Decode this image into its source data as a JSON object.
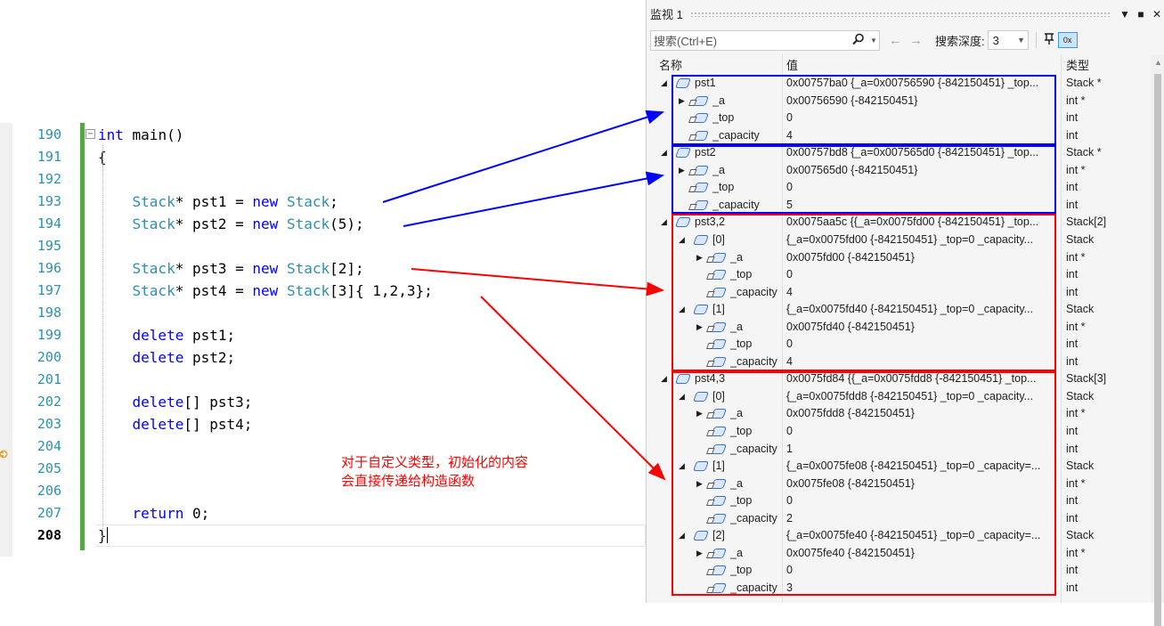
{
  "editor": {
    "lines": [
      {
        "num": "190",
        "code": [
          {
            "t": "int",
            "c": "kw"
          },
          {
            "t": " main()"
          }
        ]
      },
      {
        "num": "191",
        "code": [
          {
            "t": "{"
          }
        ]
      },
      {
        "num": "192",
        "code": []
      },
      {
        "num": "193",
        "code": [
          {
            "t": "    "
          },
          {
            "t": "Stack",
            "c": "ty"
          },
          {
            "t": "* pst1 = "
          },
          {
            "t": "new",
            "c": "kw"
          },
          {
            "t": " "
          },
          {
            "t": "Stack",
            "c": "ty"
          },
          {
            "t": ";"
          }
        ]
      },
      {
        "num": "194",
        "code": [
          {
            "t": "    "
          },
          {
            "t": "Stack",
            "c": "ty"
          },
          {
            "t": "* pst2 = "
          },
          {
            "t": "new",
            "c": "kw"
          },
          {
            "t": " "
          },
          {
            "t": "Stack",
            "c": "ty"
          },
          {
            "t": "(5);"
          }
        ]
      },
      {
        "num": "195",
        "code": []
      },
      {
        "num": "196",
        "code": [
          {
            "t": "    "
          },
          {
            "t": "Stack",
            "c": "ty"
          },
          {
            "t": "* pst3 = "
          },
          {
            "t": "new",
            "c": "kw"
          },
          {
            "t": " "
          },
          {
            "t": "Stack",
            "c": "ty"
          },
          {
            "t": "[2];"
          }
        ]
      },
      {
        "num": "197",
        "code": [
          {
            "t": "    "
          },
          {
            "t": "Stack",
            "c": "ty"
          },
          {
            "t": "* pst4 = "
          },
          {
            "t": "new",
            "c": "kw"
          },
          {
            "t": " "
          },
          {
            "t": "Stack",
            "c": "ty"
          },
          {
            "t": "[3]{ 1,2,3};"
          }
        ]
      },
      {
        "num": "198",
        "code": []
      },
      {
        "num": "199",
        "code": [
          {
            "t": "    "
          },
          {
            "t": "delete",
            "c": "kw"
          },
          {
            "t": " pst1;"
          }
        ]
      },
      {
        "num": "200",
        "code": [
          {
            "t": "    "
          },
          {
            "t": "delete",
            "c": "kw"
          },
          {
            "t": " pst2;"
          }
        ]
      },
      {
        "num": "201",
        "code": []
      },
      {
        "num": "202",
        "code": [
          {
            "t": "    "
          },
          {
            "t": "delete",
            "c": "kw"
          },
          {
            "t": "[] pst3;"
          }
        ]
      },
      {
        "num": "203",
        "code": [
          {
            "t": "    "
          },
          {
            "t": "delete",
            "c": "kw"
          },
          {
            "t": "[] pst4;"
          }
        ]
      },
      {
        "num": "204",
        "code": []
      },
      {
        "num": "205",
        "code": []
      },
      {
        "num": "206",
        "code": []
      },
      {
        "num": "207",
        "code": [
          {
            "t": "    "
          },
          {
            "t": "return",
            "c": "kw"
          },
          {
            "t": " 0;"
          }
        ]
      },
      {
        "num": "208",
        "code": [
          {
            "t": "}"
          }
        ]
      }
    ],
    "current_line": "208"
  },
  "annotation": {
    "line1": "对于自定义类型，初始化的内容",
    "line2": "会直接传递给构造函数"
  },
  "watch": {
    "title": "监视 1",
    "buttons": {
      "dropdown": "▼",
      "maximize": "■",
      "close": "✕"
    },
    "search_placeholder": "搜索(Ctrl+E)",
    "search_icon": "search-icon",
    "depth_label": "搜索深度:",
    "depth_value": "3",
    "columns": {
      "name": "名称",
      "value": "值",
      "type": "类型"
    },
    "rows": [
      {
        "level": 0,
        "exp": "open",
        "icon": "obj",
        "name": "pst1",
        "value": "0x00757ba0 {_a=0x00756590 {-842150451} _top...",
        "type": "Stack *"
      },
      {
        "level": 1,
        "exp": "closed",
        "icon": "lock",
        "name": "_a",
        "value": "0x00756590 {-842150451}",
        "type": "int *"
      },
      {
        "level": 1,
        "exp": "",
        "icon": "lock",
        "name": "_top",
        "value": "0",
        "type": "int"
      },
      {
        "level": 1,
        "exp": "",
        "icon": "lock",
        "name": "_capacity",
        "value": "4",
        "type": "int"
      },
      {
        "level": 0,
        "exp": "open",
        "icon": "obj",
        "name": "pst2",
        "value": "0x00757bd8 {_a=0x007565d0 {-842150451} _top...",
        "type": "Stack *"
      },
      {
        "level": 1,
        "exp": "closed",
        "icon": "lock",
        "name": "_a",
        "value": "0x007565d0 {-842150451}",
        "type": "int *"
      },
      {
        "level": 1,
        "exp": "",
        "icon": "lock",
        "name": "_top",
        "value": "0",
        "type": "int"
      },
      {
        "level": 1,
        "exp": "",
        "icon": "lock",
        "name": "_capacity",
        "value": "5",
        "type": "int"
      },
      {
        "level": 0,
        "exp": "open",
        "icon": "obj",
        "name": "pst3,2",
        "value": "0x0075aa5c {{_a=0x0075fd00 {-842150451} _top...",
        "type": "Stack[2]"
      },
      {
        "level": 1,
        "exp": "open",
        "icon": "obj",
        "name": "[0]",
        "value": "{_a=0x0075fd00 {-842150451} _top=0 _capacity...",
        "type": "Stack"
      },
      {
        "level": 2,
        "exp": "closed",
        "icon": "lock",
        "name": "_a",
        "value": "0x0075fd00 {-842150451}",
        "type": "int *"
      },
      {
        "level": 2,
        "exp": "",
        "icon": "lock",
        "name": "_top",
        "value": "0",
        "type": "int"
      },
      {
        "level": 2,
        "exp": "",
        "icon": "lock",
        "name": "_capacity",
        "value": "4",
        "type": "int"
      },
      {
        "level": 1,
        "exp": "open",
        "icon": "obj",
        "name": "[1]",
        "value": "{_a=0x0075fd40 {-842150451} _top=0 _capacity...",
        "type": "Stack"
      },
      {
        "level": 2,
        "exp": "closed",
        "icon": "lock",
        "name": "_a",
        "value": "0x0075fd40 {-842150451}",
        "type": "int *"
      },
      {
        "level": 2,
        "exp": "",
        "icon": "lock",
        "name": "_top",
        "value": "0",
        "type": "int"
      },
      {
        "level": 2,
        "exp": "",
        "icon": "lock",
        "name": "_capacity",
        "value": "4",
        "type": "int"
      },
      {
        "level": 0,
        "exp": "open",
        "icon": "obj",
        "name": "pst4,3",
        "value": "0x0075fd84 {{_a=0x0075fdd8 {-842150451} _top...",
        "type": "Stack[3]"
      },
      {
        "level": 1,
        "exp": "open",
        "icon": "obj",
        "name": "[0]",
        "value": "{_a=0x0075fdd8 {-842150451} _top=0 _capacity...",
        "type": "Stack"
      },
      {
        "level": 2,
        "exp": "closed",
        "icon": "lock",
        "name": "_a",
        "value": "0x0075fdd8 {-842150451}",
        "type": "int *"
      },
      {
        "level": 2,
        "exp": "",
        "icon": "lock",
        "name": "_top",
        "value": "0",
        "type": "int"
      },
      {
        "level": 2,
        "exp": "",
        "icon": "lock",
        "name": "_capacity",
        "value": "1",
        "type": "int"
      },
      {
        "level": 1,
        "exp": "open",
        "icon": "obj",
        "name": "[1]",
        "value": "{_a=0x0075fe08 {-842150451} _top=0 _capacity=...",
        "type": "Stack"
      },
      {
        "level": 2,
        "exp": "closed",
        "icon": "lock",
        "name": "_a",
        "value": "0x0075fe08 {-842150451}",
        "type": "int *"
      },
      {
        "level": 2,
        "exp": "",
        "icon": "lock",
        "name": "_top",
        "value": "0",
        "type": "int"
      },
      {
        "level": 2,
        "exp": "",
        "icon": "lock",
        "name": "_capacity",
        "value": "2",
        "type": "int"
      },
      {
        "level": 1,
        "exp": "open",
        "icon": "obj",
        "name": "[2]",
        "value": "{_a=0x0075fe40 {-842150451} _top=0 _capacity=...",
        "type": "Stack"
      },
      {
        "level": 2,
        "exp": "closed",
        "icon": "lock",
        "name": "_a",
        "value": "0x0075fe40 {-842150451}",
        "type": "int *"
      },
      {
        "level": 2,
        "exp": "",
        "icon": "lock",
        "name": "_top",
        "value": "0",
        "type": "int"
      },
      {
        "level": 2,
        "exp": "",
        "icon": "lock",
        "name": "_capacity",
        "value": "3",
        "type": "int"
      }
    ]
  },
  "colors": {
    "blue_box": "#0000ff",
    "red_box": "#ff0000"
  }
}
